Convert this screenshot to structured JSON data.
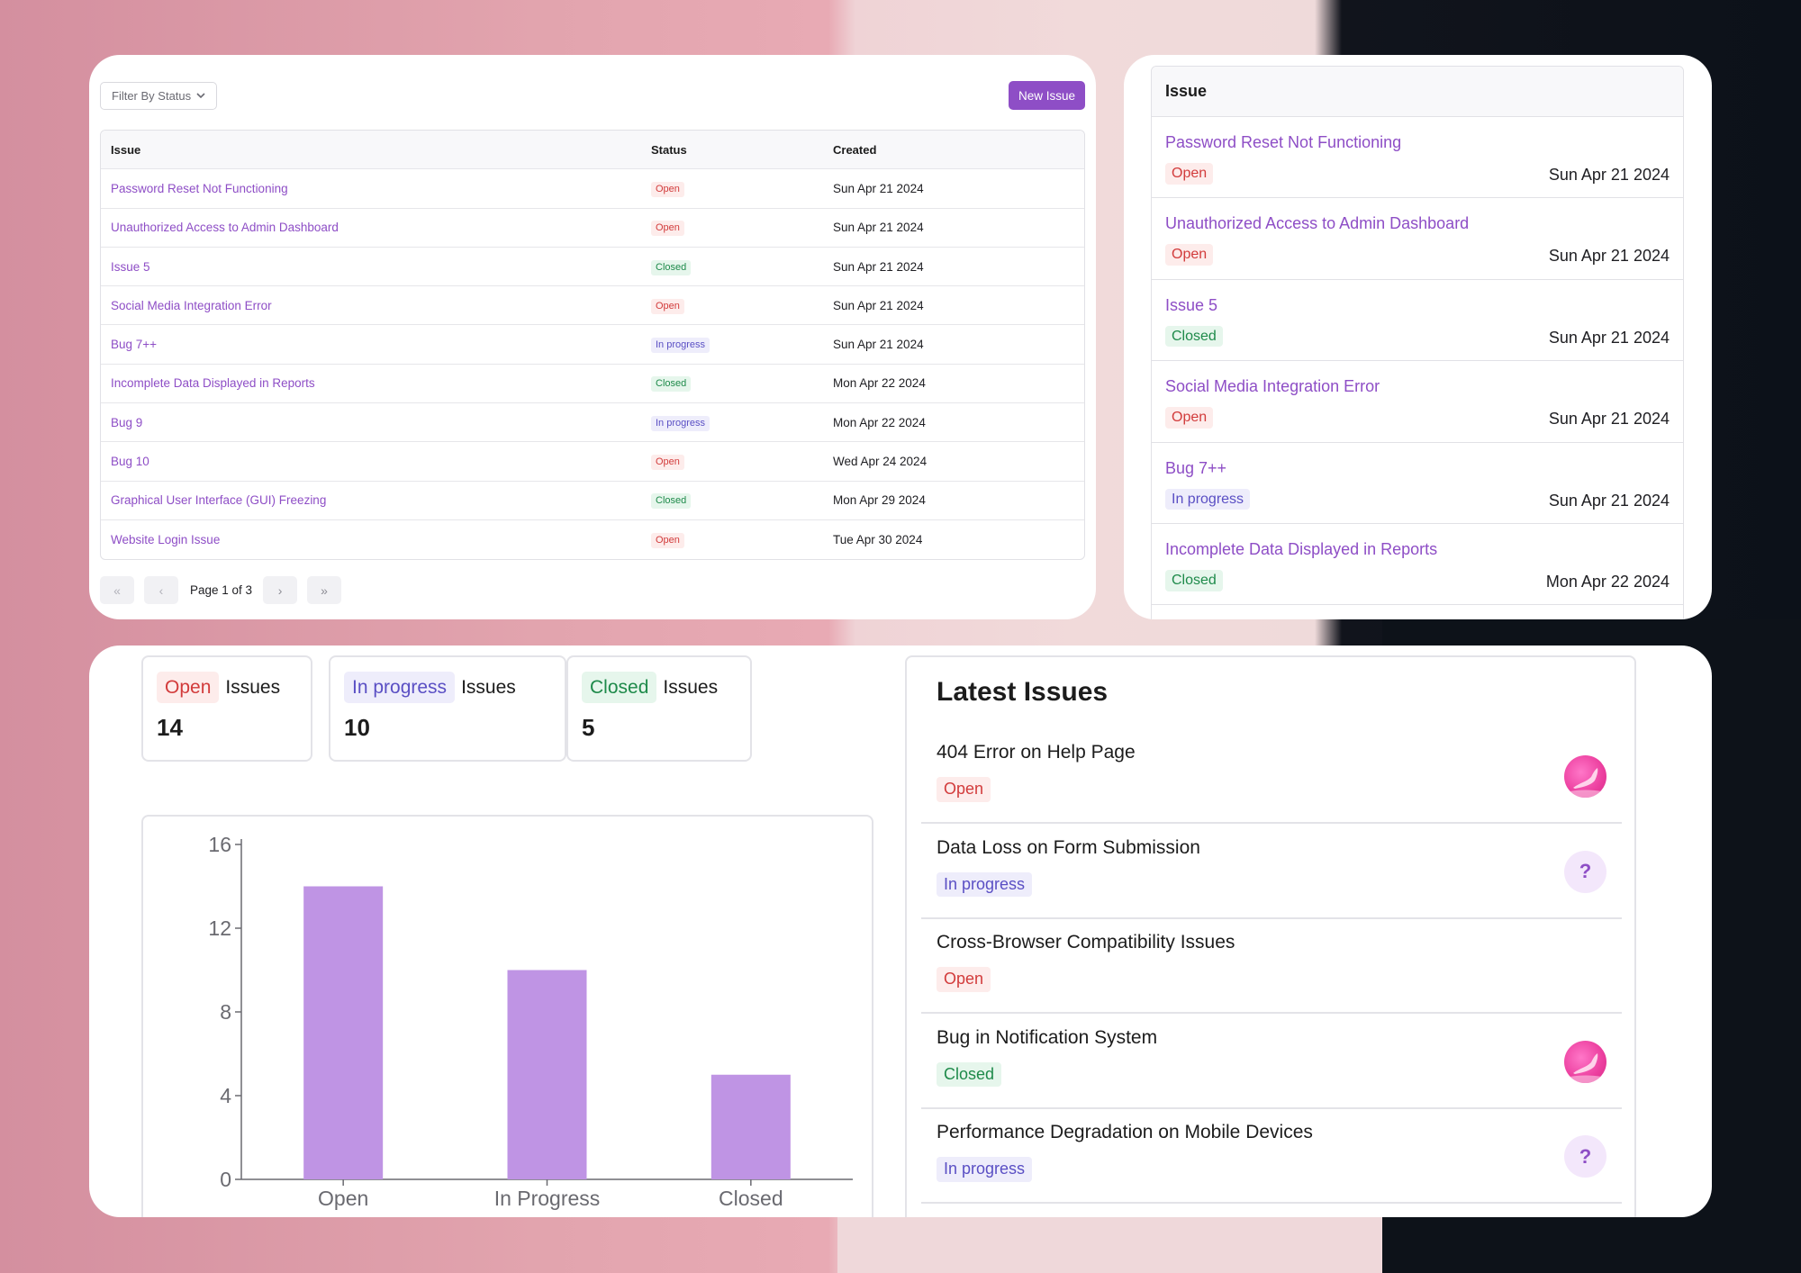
{
  "colors": {
    "accent": "#8e4ec6",
    "open_fg": "#d23b3b",
    "open_bg": "#fdeceb",
    "progress_fg": "#5a4fc4",
    "progress_bg": "#eeedfb",
    "closed_fg": "#1e8a4a",
    "closed_bg": "#e6f6ec",
    "bar": "#bf94e4"
  },
  "table_view": {
    "filter_label": "Filter By Status",
    "filter_icon": "chevron-down-icon",
    "new_issue_label": "New Issue",
    "columns": [
      "Issue",
      "Status",
      "Created"
    ],
    "rows": [
      {
        "title": "Password Reset Not Functioning",
        "status": "Open",
        "status_key": "open",
        "created": "Sun Apr 21 2024"
      },
      {
        "title": "Unauthorized Access to Admin Dashboard",
        "status": "Open",
        "status_key": "open",
        "created": "Sun Apr 21 2024"
      },
      {
        "title": "Issue 5",
        "status": "Closed",
        "status_key": "closed",
        "created": "Sun Apr 21 2024"
      },
      {
        "title": "Social Media Integration Error",
        "status": "Open",
        "status_key": "open",
        "created": "Sun Apr 21 2024"
      },
      {
        "title": "Bug 7++",
        "status": "In progress",
        "status_key": "prog",
        "created": "Sun Apr 21 2024"
      },
      {
        "title": "Incomplete Data Displayed in Reports",
        "status": "Closed",
        "status_key": "closed",
        "created": "Mon Apr 22 2024"
      },
      {
        "title": "Bug 9",
        "status": "In progress",
        "status_key": "prog",
        "created": "Mon Apr 22 2024"
      },
      {
        "title": "Bug 10",
        "status": "Open",
        "status_key": "open",
        "created": "Wed Apr 24 2024"
      },
      {
        "title": "Graphical User Interface (GUI) Freezing",
        "status": "Closed",
        "status_key": "closed",
        "created": "Mon Apr 29 2024"
      },
      {
        "title": "Website Login Issue",
        "status": "Open",
        "status_key": "open",
        "created": "Tue Apr 30 2024"
      }
    ],
    "pagination": {
      "text": "Page 1 of 3",
      "first": "«",
      "prev": "‹",
      "next": "›",
      "last": "»"
    }
  },
  "list_view": {
    "header": "Issue",
    "items": [
      {
        "title": "Password Reset Not Functioning",
        "status": "Open",
        "status_key": "open",
        "created": "Sun Apr 21 2024"
      },
      {
        "title": "Unauthorized Access to Admin Dashboard",
        "status": "Open",
        "status_key": "open",
        "created": "Sun Apr 21 2024"
      },
      {
        "title": "Issue 5",
        "status": "Closed",
        "status_key": "closed",
        "created": "Sun Apr 21 2024"
      },
      {
        "title": "Social Media Integration Error",
        "status": "Open",
        "status_key": "open",
        "created": "Sun Apr 21 2024"
      },
      {
        "title": "Bug 7++",
        "status": "In progress",
        "status_key": "prog",
        "created": "Sun Apr 21 2024"
      },
      {
        "title": "Incomplete Data Displayed in Reports",
        "status": "Closed",
        "status_key": "closed",
        "created": "Mon Apr 22 2024"
      }
    ]
  },
  "summary": {
    "cards": [
      {
        "badge": "Open",
        "status_key": "open",
        "label": "Issues",
        "count": "14"
      },
      {
        "badge": "In progress",
        "status_key": "prog",
        "label": "Issues",
        "count": "10"
      },
      {
        "badge": "Closed",
        "status_key": "closed",
        "label": "Issues",
        "count": "5"
      }
    ]
  },
  "chart_data": {
    "type": "bar",
    "categories": [
      "Open",
      "In Progress",
      "Closed"
    ],
    "values": [
      14,
      10,
      5
    ],
    "yticks": [
      0,
      4,
      8,
      12,
      16
    ],
    "ylim": [
      0,
      16
    ],
    "xlabel": "",
    "ylabel": "",
    "title": "",
    "grid": false
  },
  "latest": {
    "title": "Latest Issues",
    "items": [
      {
        "title": "404 Error on Help Page",
        "status": "Open",
        "status_key": "open",
        "avatar": "user-avatar-image"
      },
      {
        "title": "Data Loss on Form Submission",
        "status": "In progress",
        "status_key": "prog",
        "avatar": "?"
      },
      {
        "title": "Cross-Browser Compatibility Issues",
        "status": "Open",
        "status_key": "open",
        "avatar": ""
      },
      {
        "title": "Bug in Notification System",
        "status": "Closed",
        "status_key": "closed",
        "avatar": "user-avatar-image"
      },
      {
        "title": "Performance Degradation on Mobile Devices",
        "status": "In progress",
        "status_key": "prog",
        "avatar": "?"
      }
    ]
  }
}
